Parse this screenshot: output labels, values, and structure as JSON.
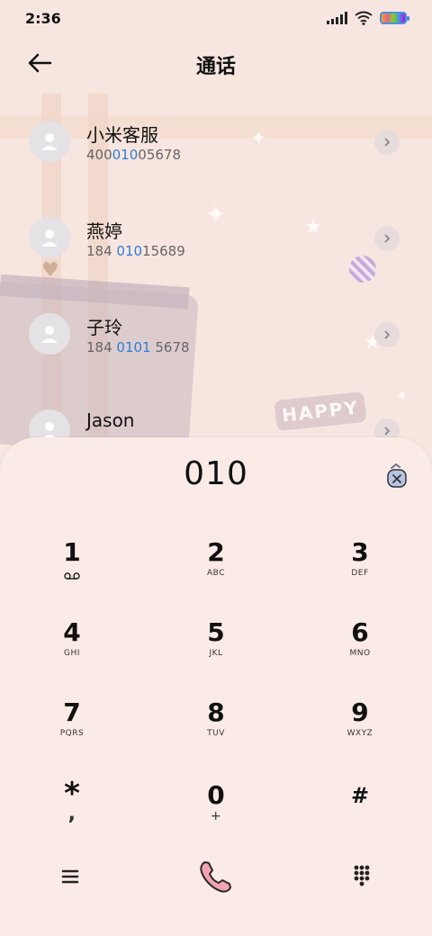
{
  "status_bar": {
    "time": "2:36"
  },
  "header": {
    "title": "通话",
    "back_icon": "back-arrow-icon"
  },
  "contacts": [
    {
      "name": "小米客服",
      "number_pre": "400",
      "number_match": "010",
      "number_post": "05678"
    },
    {
      "name": "燕婷",
      "number_pre": "184 ",
      "number_match": "010",
      "number_post": "15689"
    },
    {
      "name": "子玲",
      "number_pre": "184 ",
      "number_match": "0101",
      "number_post": " 5678"
    },
    {
      "name": "Jason",
      "number_pre": "",
      "number_match": "",
      "number_post": ""
    }
  ],
  "dialpad": {
    "input": "010",
    "keys": [
      {
        "digit": "1",
        "letters": ""
      },
      {
        "digit": "2",
        "letters": "ABC"
      },
      {
        "digit": "3",
        "letters": "DEF"
      },
      {
        "digit": "4",
        "letters": "GHI"
      },
      {
        "digit": "5",
        "letters": "JKL"
      },
      {
        "digit": "6",
        "letters": "MNO"
      },
      {
        "digit": "7",
        "letters": "PQRS"
      },
      {
        "digit": "8",
        "letters": "TUV"
      },
      {
        "digit": "9",
        "letters": "WXYZ"
      },
      {
        "digit": "*",
        "letters": ","
      },
      {
        "digit": "0",
        "letters": "+"
      },
      {
        "digit": "#",
        "letters": ""
      }
    ]
  },
  "background": {
    "happy_label": "HAPPY"
  },
  "colors": {
    "accent": "#2d7ed8",
    "call_button": "#f1a3b0",
    "panel": "#fbebe7"
  }
}
